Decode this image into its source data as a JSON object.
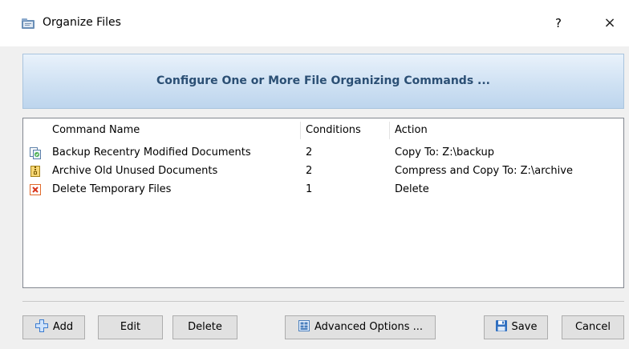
{
  "window": {
    "title": "Organize Files",
    "help_label": "?",
    "close_label": "×"
  },
  "banner": {
    "text": "Configure One or More File Organizing Commands ..."
  },
  "list": {
    "columns": [
      "Command Name",
      "Conditions",
      "Action"
    ],
    "rows": [
      {
        "icon": "copy-document-icon",
        "name": "Backup Recentry Modified Documents",
        "conditions": "2",
        "action": "Copy To: Z:\\backup"
      },
      {
        "icon": "archive-compress-icon",
        "name": "Archive Old Unused Documents",
        "conditions": "2",
        "action": "Compress and Copy To: Z:\\archive"
      },
      {
        "icon": "delete-x-icon",
        "name": "Delete Temporary Files",
        "conditions": "1",
        "action": "Delete"
      }
    ]
  },
  "buttons": {
    "add": "Add",
    "edit": "Edit",
    "delete": "Delete",
    "advanced": "Advanced Options ...",
    "save": "Save",
    "cancel": "Cancel"
  },
  "colors": {
    "banner_text": "#2b4f74",
    "banner_border": "#a9c4de",
    "button_face": "#e1e1e1",
    "save_icon": "#2f6fc0"
  }
}
